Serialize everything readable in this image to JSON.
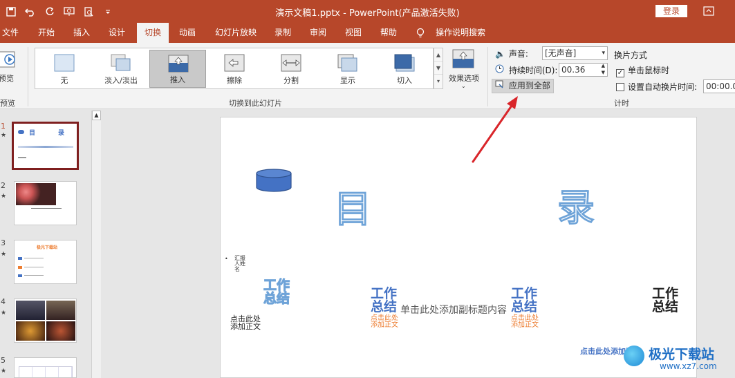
{
  "window": {
    "doc_title": "演示文稿1.pptx  -  PowerPoint(产品激活失败)",
    "login_label": "登录"
  },
  "tabs": [
    "文件",
    "开始",
    "插入",
    "设计",
    "切换",
    "动画",
    "幻灯片放映",
    "录制",
    "审阅",
    "视图",
    "帮助",
    "操作说明搜索"
  ],
  "active_tab": "切换",
  "ribbon": {
    "preview_label": "预览",
    "preview_group": "预览",
    "transitions": [
      "无",
      "淡入/淡出",
      "推入",
      "擦除",
      "分割",
      "显示",
      "切入"
    ],
    "selected_transition": "推入",
    "effect_options": "效果选项",
    "group_transition": "切换到此幻灯片",
    "sound_label": "声音:",
    "sound_value": "[无声音]",
    "duration_label": "持续时间(D):",
    "duration_value": "00.36",
    "apply_all": "应用到全部",
    "advance_title": "换片方式",
    "on_click": "单击鼠标时",
    "auto_after": "设置自动换片时间:",
    "auto_value": "00:00.00",
    "timing_group": "计时"
  },
  "slides": [
    {
      "num": "1"
    },
    {
      "num": "2"
    },
    {
      "num": "3"
    },
    {
      "num": "4"
    },
    {
      "num": "5"
    }
  ],
  "thumb_texts": {
    "t1_a": "目",
    "t1_b": "录",
    "t3_title": "极光下载站"
  },
  "slide": {
    "char1": "目",
    "char2": "录",
    "bullet_text": "汇报人姓名",
    "wz1": "工作总结",
    "wz2": "工作总结",
    "wz3": "工作总结",
    "wz4": "工作总结",
    "sub_main": "单击此处添加副标题内容",
    "click_add": "点击此处添加正文",
    "click_orange1": "点击此处添加正文",
    "click_orange2": "点击此处添加正文",
    "bottom_blue": "点击此处添加正文"
  },
  "watermark": {
    "brand": "极光下载站",
    "url": "www.xz7.com"
  },
  "colors": {
    "accent": "#b7472a",
    "ribbon": "#f3f3f3",
    "arrow": "#d9252a",
    "slide_blue": "#4472c4",
    "slide_orange": "#ed7d31"
  }
}
